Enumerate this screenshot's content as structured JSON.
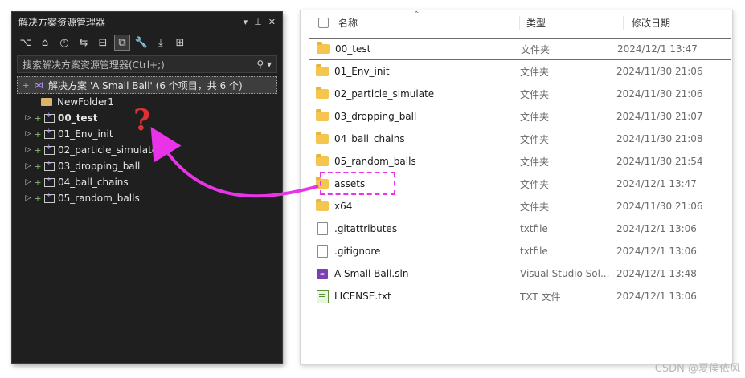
{
  "solution_explorer": {
    "title": "解决方案资源管理器",
    "title_icons": [
      "dropdown-arrow",
      "pin",
      "close"
    ],
    "search_placeholder": "搜索解决方案资源管理器(Ctrl+;)",
    "solution_label": "解决方案 'A Small Ball' (6 个项目，共 6 个)",
    "tree": [
      {
        "label": "NewFolder1",
        "kind": "folder",
        "bold": false
      },
      {
        "label": "00_test",
        "kind": "project",
        "bold": true
      },
      {
        "label": "01_Env_init",
        "kind": "project",
        "bold": false
      },
      {
        "label": "02_particle_simulate",
        "kind": "project",
        "bold": false
      },
      {
        "label": "03_dropping_ball",
        "kind": "project",
        "bold": false
      },
      {
        "label": "04_ball_chains",
        "kind": "project",
        "bold": false
      },
      {
        "label": "05_random_balls",
        "kind": "project",
        "bold": false
      }
    ]
  },
  "explorer": {
    "columns": {
      "name": "名称",
      "type": "类型",
      "date": "修改日期"
    },
    "rows": [
      {
        "name": "00_test",
        "type": "文件夹",
        "date": "2024/12/1 13:47",
        "icon": "folder"
      },
      {
        "name": "01_Env_init",
        "type": "文件夹",
        "date": "2024/11/30 21:06",
        "icon": "folder"
      },
      {
        "name": "02_particle_simulate",
        "type": "文件夹",
        "date": "2024/11/30 21:06",
        "icon": "folder"
      },
      {
        "name": "03_dropping_ball",
        "type": "文件夹",
        "date": "2024/11/30 21:07",
        "icon": "folder"
      },
      {
        "name": "04_ball_chains",
        "type": "文件夹",
        "date": "2024/11/30 21:08",
        "icon": "folder"
      },
      {
        "name": "05_random_balls",
        "type": "文件夹",
        "date": "2024/11/30 21:54",
        "icon": "folder"
      },
      {
        "name": "assets",
        "type": "文件夹",
        "date": "2024/12/1 13:47",
        "icon": "folder"
      },
      {
        "name": "x64",
        "type": "文件夹",
        "date": "2024/11/30 21:06",
        "icon": "folder"
      },
      {
        "name": ".gitattributes",
        "type": "txtfile",
        "date": "2024/12/1 13:06",
        "icon": "file"
      },
      {
        "name": ".gitignore",
        "type": "txtfile",
        "date": "2024/12/1 13:06",
        "icon": "file"
      },
      {
        "name": "A Small Ball.sln",
        "type": "Visual Studio Sol...",
        "date": "2024/12/1 13:48",
        "icon": "sln"
      },
      {
        "name": "LICENSE.txt",
        "type": "TXT 文件",
        "date": "2024/12/1 13:06",
        "icon": "txt"
      }
    ]
  },
  "annotation": {
    "question_mark": "?",
    "color": "#e833e8"
  },
  "watermark": "CSDN @夏侯依风"
}
